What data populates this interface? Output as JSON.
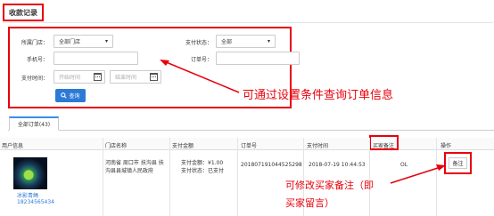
{
  "page": {
    "section_title": "收款记录"
  },
  "filters": {
    "store_label": "所属门店：",
    "store_value": "全部门店",
    "pay_status_label": "支付状态：",
    "pay_status_value": "全部",
    "phone_label": "手机号：",
    "phone_value": "",
    "order_no_label": "订单号：",
    "order_no_value": "",
    "pay_time_label": "支付时间：",
    "start_placeholder": "开始时间",
    "end_placeholder": "结束时间",
    "search_label": "查询"
  },
  "annotations": {
    "filter_hint": "可通过设置条件查询订单信息",
    "remark_hint_line1": "可修改买家备注（即",
    "remark_hint_line2": "买家留言）"
  },
  "tabs": [
    {
      "label": "全部订单(43)"
    }
  ],
  "table": {
    "headers": [
      "用户信息",
      "门店名称",
      "支付金额",
      "订单号",
      "支付时间",
      "买家备注",
      "操作"
    ],
    "rows": [
      {
        "user_name": "冰影青绳",
        "user_phone": "18234565434",
        "store_name_line1": "河南省 周口市 扶沟县 扶",
        "store_name_line2": "沟县县城镇人民政府",
        "amount_line1": "支付金额：¥1.00",
        "amount_line2": "支付状态：已支付",
        "order_no": "201807191044525298",
        "pay_time": "2018-07-19 10:44:53",
        "remark": "OL",
        "action_label": "备注"
      }
    ]
  },
  "colors": {
    "accent_red": "#e8000b",
    "primary_blue": "#2d7ad6"
  }
}
